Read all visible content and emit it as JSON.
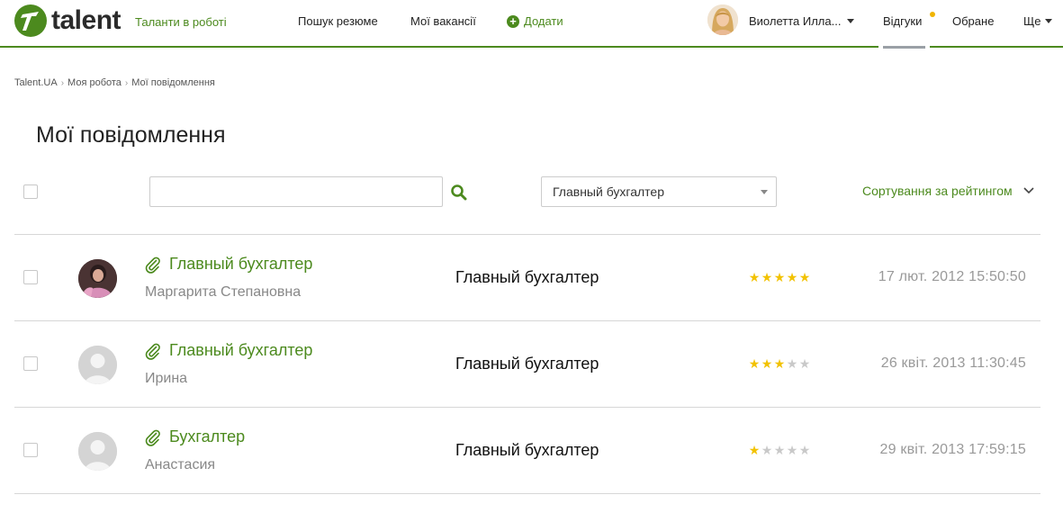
{
  "header": {
    "logo_text": "talent",
    "tagline": "Таланти в роботі",
    "nav": {
      "search_resume": "Пошук резюме",
      "my_vacancies": "Мої вакансії",
      "add": "Додати"
    },
    "user_name": "Виолетта Илла...",
    "responses": "Відгуки",
    "favorites": "Обране",
    "more": "Ще"
  },
  "breadcrumb": {
    "items": [
      "Talent.UA",
      "Моя робота",
      "Мої повідомлення"
    ]
  },
  "page": {
    "title": "Мої повідомлення"
  },
  "toolbar": {
    "search_value": "",
    "selected_vacancy": "Главный бухгалтер",
    "sort_label": "Сортування за рейтингом"
  },
  "messages": [
    {
      "title": "Главный бухгалтер",
      "sender": "Маргарита Степановна",
      "vacancy": "Главный бухгалтер",
      "rating": 5,
      "date": "17 лют. 2012 15:50:50"
    },
    {
      "title": "Главный бухгалтер",
      "sender": "Ирина",
      "vacancy": "Главный бухгалтер",
      "rating": 3,
      "date": "26 квіт. 2013 11:30:45"
    },
    {
      "title": "Бухгалтер",
      "sender": "Анастасия",
      "vacancy": "Главный бухгалтер",
      "rating": 1,
      "date": "29 квіт. 2013 17:59:15"
    }
  ],
  "colors": {
    "brand_green": "#4c8a1e",
    "star_on": "#f2c200",
    "star_off": "#c9c9c9",
    "notify": "#f0b400"
  }
}
